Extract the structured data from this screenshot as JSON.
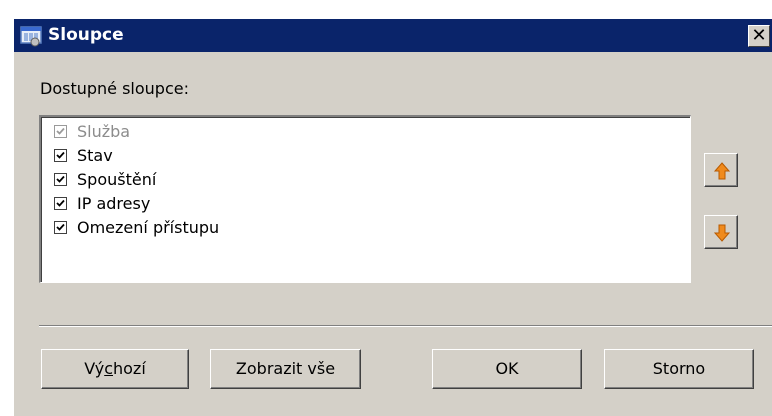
{
  "window": {
    "title": "Sloupce",
    "close_glyph": "✕",
    "title_bar_color": "#0a246a",
    "app_icon": "columns-window-icon"
  },
  "columns_list": {
    "label": "Dostupné sloupce:",
    "items": [
      {
        "label": "Služba",
        "checked": true,
        "disabled": true
      },
      {
        "label": "Stav",
        "checked": true,
        "disabled": false
      },
      {
        "label": "Spouštění",
        "checked": true,
        "disabled": false
      },
      {
        "label": "IP adresy",
        "checked": true,
        "disabled": false
      },
      {
        "label": "Omezení přístupu",
        "checked": true,
        "disabled": false
      }
    ]
  },
  "side_buttons": {
    "move_up_icon": "arrow-up-icon",
    "move_down_icon": "arrow-down-icon",
    "arrow_color": "#e07a10"
  },
  "buttons": {
    "default_label_pre": "Vý",
    "default_label_accel": "c",
    "default_label_post": "hozí",
    "show_all_label": "Zobrazit vše",
    "ok_label": "OK",
    "cancel_label": "Storno"
  }
}
